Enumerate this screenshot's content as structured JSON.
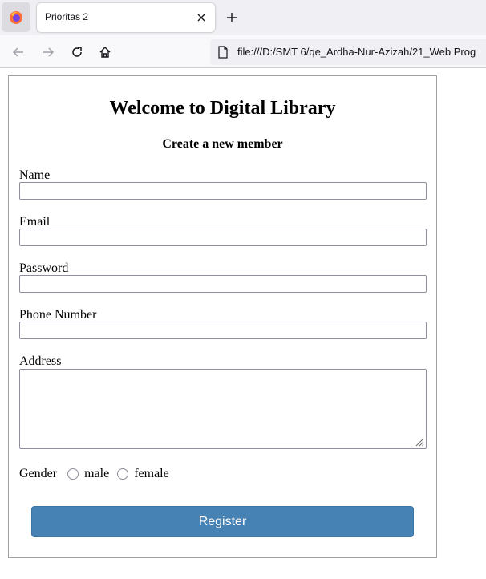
{
  "browser": {
    "tab_title": "Prioritas 2",
    "url": "file:///D:/SMT 6/qe_Ardha-Nur-Azizah/21_Web Prog"
  },
  "page": {
    "title": "Welcome to Digital Library",
    "subtitle": "Create a new member",
    "fields": {
      "name_label": "Name",
      "email_label": "Email",
      "password_label": "Password",
      "phone_label": "Phone Number",
      "address_label": "Address"
    },
    "gender": {
      "label": "Gender",
      "options": [
        "male",
        "female"
      ]
    },
    "register_label": "Register"
  },
  "colors": {
    "button_bg": "#4682b4",
    "button_text": "#ffffff",
    "border": "#a0a0a0"
  },
  "icons": [
    "firefox-icon",
    "close-icon",
    "plus-icon",
    "back-arrow-icon",
    "forward-arrow-icon",
    "reload-icon",
    "home-icon",
    "page-icon"
  ]
}
